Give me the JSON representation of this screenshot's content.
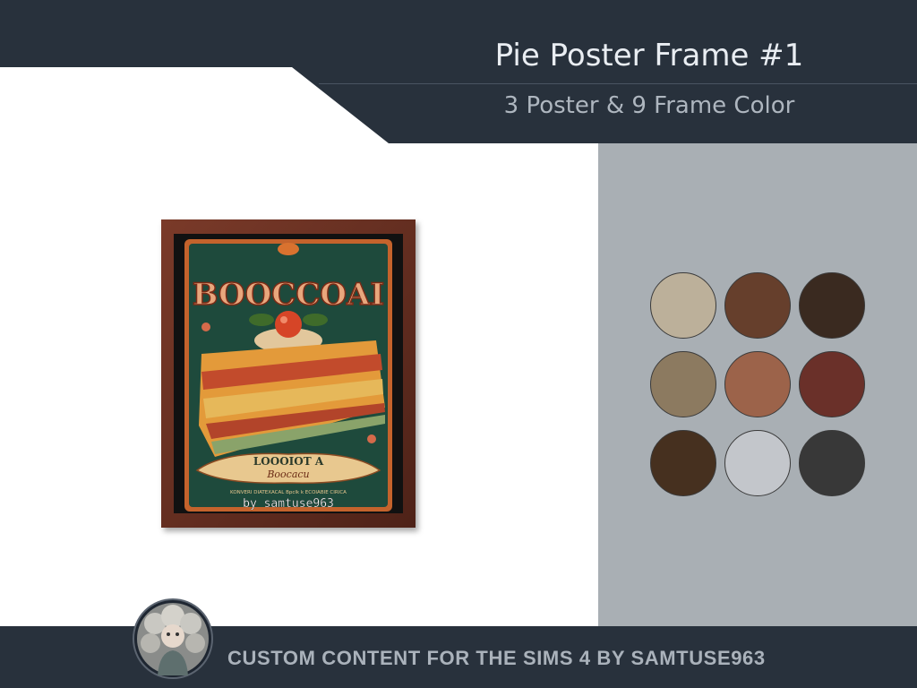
{
  "header": {
    "title": "Pie Poster Frame #1",
    "subtitle": "3 Poster & 9 Frame Color"
  },
  "poster": {
    "headline": "BOOCCOAI",
    "banner_line1": "LOOOIOT A",
    "banner_line2": "Boocacu",
    "small_print": "KONVERI DIATEXACAL  Bpclk  k  ECOIABIE CIRICA",
    "watermark": "by samtuse963"
  },
  "swatches": {
    "colors": [
      "#bcb09a",
      "#663f2c",
      "#3a2a20",
      "#8c7a60",
      "#9c634a",
      "#6a3029",
      "#46301f",
      "#c3c6cb",
      "#383838"
    ]
  },
  "footer": {
    "text": "CUSTOM CONTENT FOR THE SIMS 4 BY SAMTUSE963"
  },
  "colors": {
    "header_bg": "#28313c",
    "panel_bg": "#a9afb4",
    "frame": "#6b2f22",
    "poster_bg": "#1e4a3c"
  }
}
